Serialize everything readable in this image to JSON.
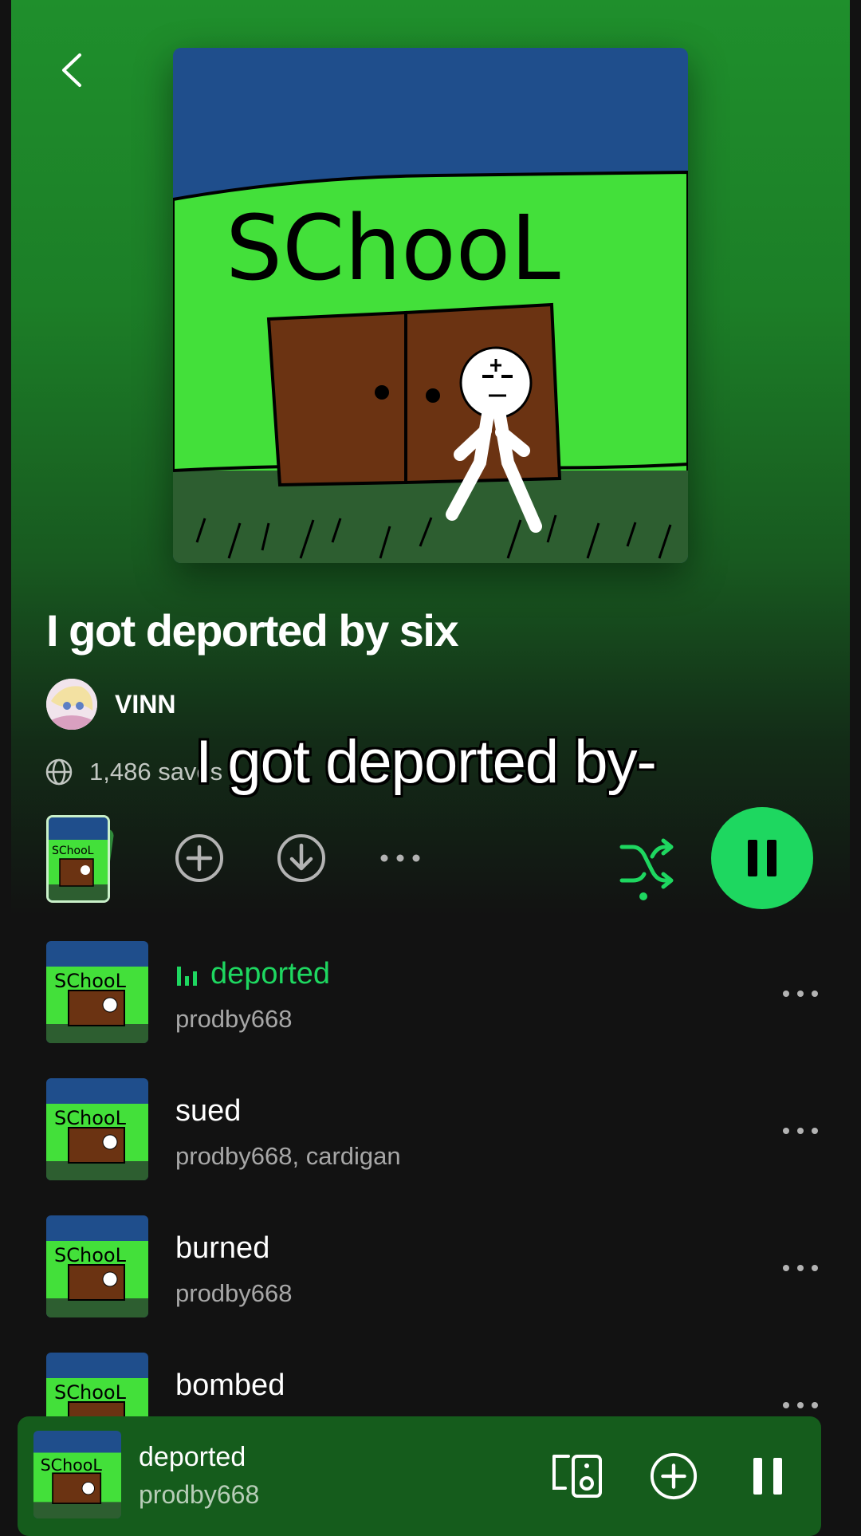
{
  "album": {
    "title": "I got deported by six",
    "artist": "VINN",
    "saves_text": "1,486 saves",
    "cover_text": "SChooL"
  },
  "caption": "I got deported by-",
  "tracks": [
    {
      "title": "deported",
      "artist": "prodby668",
      "playing": true
    },
    {
      "title": "sued",
      "artist": "prodby668, cardigan",
      "playing": false
    },
    {
      "title": "burned",
      "artist": "prodby668",
      "playing": false
    },
    {
      "title": "bombed",
      "artist": "",
      "playing": false
    }
  ],
  "now_playing": {
    "title": "deported",
    "artist": "prodby668"
  },
  "colors": {
    "accent": "#1ed760",
    "background": "#121212",
    "mini_player": "#155c1c"
  },
  "icons": [
    "back-icon",
    "globe-icon",
    "add-icon",
    "download-icon",
    "more-icon",
    "shuffle-icon",
    "pause-icon",
    "connect-device-icon"
  ]
}
